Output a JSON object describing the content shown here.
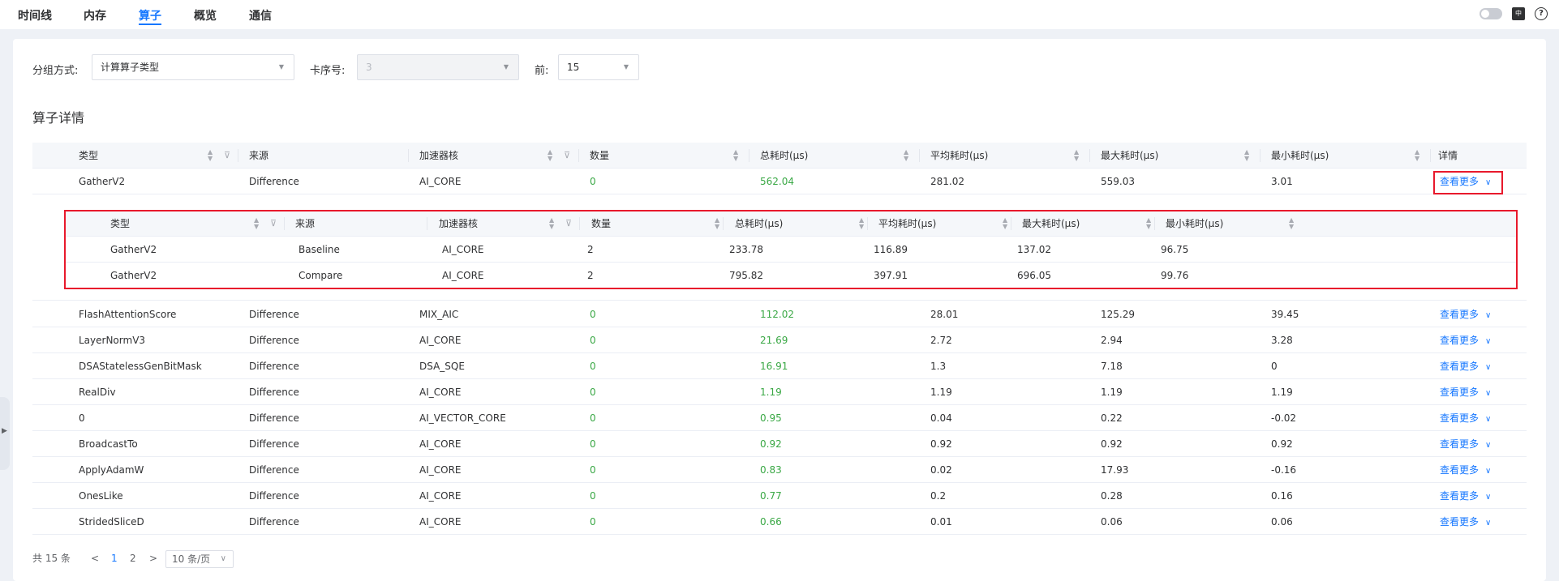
{
  "tabs": [
    {
      "label": "时间线",
      "active": false
    },
    {
      "label": "内存",
      "active": false
    },
    {
      "label": "算子",
      "active": true
    },
    {
      "label": "概览",
      "active": false
    },
    {
      "label": "通信",
      "active": false
    }
  ],
  "toolbar": {
    "lang_icon": "中",
    "help_icon": "?"
  },
  "filters": {
    "group_label": "分组方式:",
    "group_value": "计算算子类型",
    "card_label": "卡序号:",
    "card_value": "3",
    "top_label": "前:",
    "top_value": "15"
  },
  "section_title": "算子详情",
  "main_table": {
    "columns": [
      "类型",
      "来源",
      "加速器核",
      "数量",
      "总耗时(μs)",
      "平均耗时(μs)",
      "最大耗时(μs)",
      "最小耗时(μs)",
      "详情"
    ],
    "more_label": "查看更多",
    "rows": [
      {
        "type": "GatherV2",
        "source": "Difference",
        "core": "AI_CORE",
        "count": "0",
        "total": "562.04",
        "avg": "281.02",
        "max": "559.03",
        "min": "3.01"
      },
      {
        "type": "FlashAttentionScore",
        "source": "Difference",
        "core": "MIX_AIC",
        "count": "0",
        "total": "112.02",
        "avg": "28.01",
        "max": "125.29",
        "min": "39.45"
      },
      {
        "type": "LayerNormV3",
        "source": "Difference",
        "core": "AI_CORE",
        "count": "0",
        "total": "21.69",
        "avg": "2.72",
        "max": "2.94",
        "min": "3.28"
      },
      {
        "type": "DSAStatelessGenBitMask",
        "source": "Difference",
        "core": "DSA_SQE",
        "count": "0",
        "total": "16.91",
        "avg": "1.3",
        "max": "7.18",
        "min": "0"
      },
      {
        "type": "RealDiv",
        "source": "Difference",
        "core": "AI_CORE",
        "count": "0",
        "total": "1.19",
        "avg": "1.19",
        "max": "1.19",
        "min": "1.19"
      },
      {
        "type": "0",
        "source": "Difference",
        "core": "AI_VECTOR_CORE",
        "count": "0",
        "total": "0.95",
        "avg": "0.04",
        "max": "0.22",
        "min": "-0.02"
      },
      {
        "type": "BroadcastTo",
        "source": "Difference",
        "core": "AI_CORE",
        "count": "0",
        "total": "0.92",
        "avg": "0.92",
        "max": "0.92",
        "min": "0.92"
      },
      {
        "type": "ApplyAdamW",
        "source": "Difference",
        "core": "AI_CORE",
        "count": "0",
        "total": "0.83",
        "avg": "0.02",
        "max": "17.93",
        "min": "-0.16"
      },
      {
        "type": "OnesLike",
        "source": "Difference",
        "core": "AI_CORE",
        "count": "0",
        "total": "0.77",
        "avg": "0.2",
        "max": "0.28",
        "min": "0.16"
      },
      {
        "type": "StridedSliceD",
        "source": "Difference",
        "core": "AI_CORE",
        "count": "0",
        "total": "0.66",
        "avg": "0.01",
        "max": "0.06",
        "min": "0.06"
      }
    ]
  },
  "sub_table": {
    "columns": [
      "类型",
      "来源",
      "加速器核",
      "数量",
      "总耗时(μs)",
      "平均耗时(μs)",
      "最大耗时(μs)",
      "最小耗时(μs)"
    ],
    "rows": [
      {
        "type": "GatherV2",
        "source": "Baseline",
        "core": "AI_CORE",
        "count": "2",
        "total": "233.78",
        "avg": "116.89",
        "max": "137.02",
        "min": "96.75"
      },
      {
        "type": "GatherV2",
        "source": "Compare",
        "core": "AI_CORE",
        "count": "2",
        "total": "795.82",
        "avg": "397.91",
        "max": "696.05",
        "min": "99.76"
      }
    ]
  },
  "pagination": {
    "total": "共 15 条",
    "prev": "<",
    "next": ">",
    "pages": [
      "1",
      "2"
    ],
    "current_page": "1",
    "page_size": "10 条/页"
  }
}
